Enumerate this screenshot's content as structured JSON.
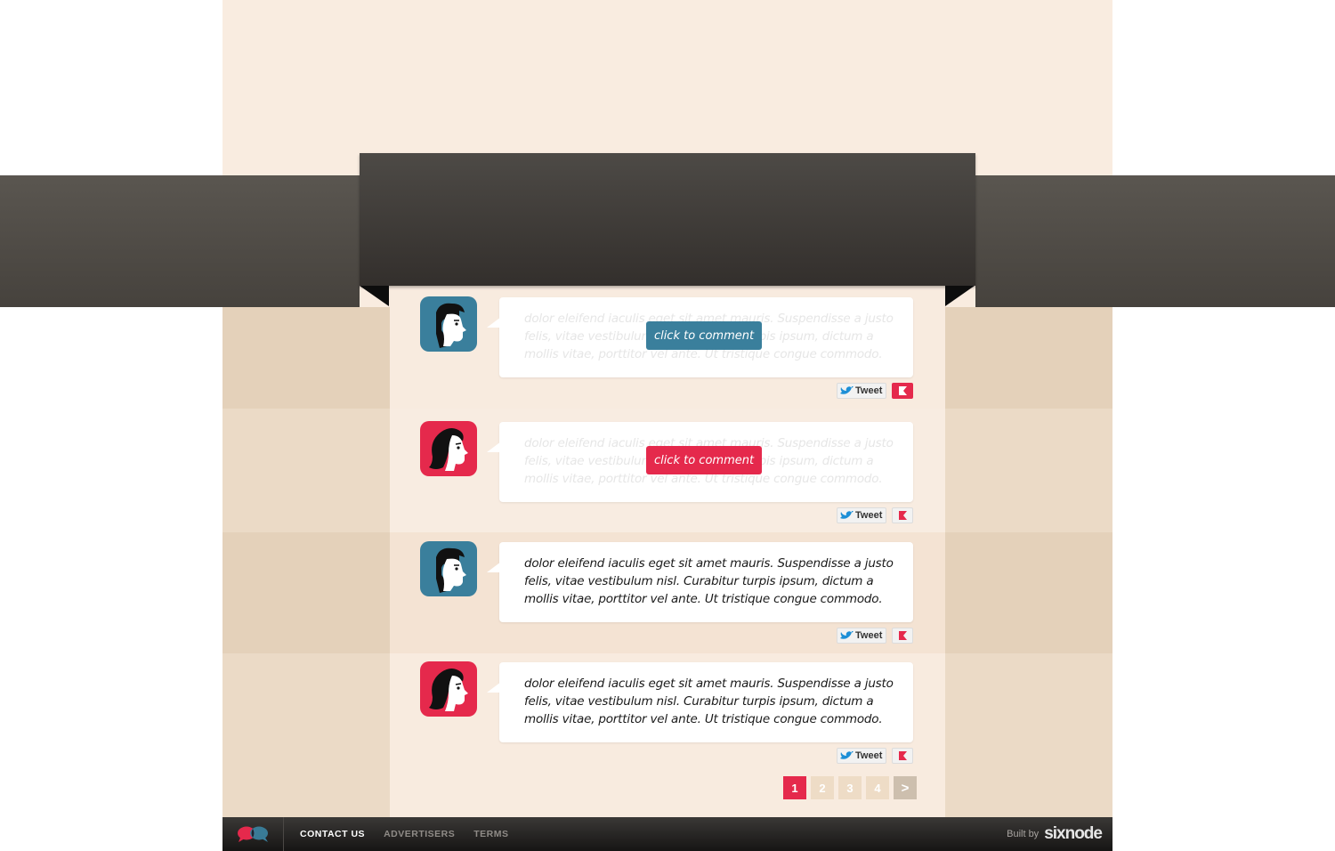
{
  "comments": [
    {
      "avatar": "male-profile-icon",
      "text": "dolor eleifend iaculis eget sit amet mauris. Suspendisse a justo felis, vitae vestibulum nisl. Curabitur turpis ipsum, dictum a mollis vitae, porttitor vel ante. Ut tristique congue commodo.",
      "cta_label": "click to comment",
      "tweet_label": "Tweet"
    },
    {
      "avatar": "female-profile-icon",
      "text": "dolor eleifend iaculis eget sit amet mauris. Suspendisse a justo felis, vitae vestibulum nisl. Curabitur turpis ipsum, dictum a mollis vitae, porttitor vel ante. Ut tristique congue commodo.",
      "cta_label": "click to comment",
      "tweet_label": "Tweet"
    },
    {
      "avatar": "male-profile-icon",
      "text": "dolor eleifend iaculis eget sit amet mauris. Suspendisse a justo felis, vitae vestibulum nisl. Curabitur turpis ipsum, dictum a mollis vitae, porttitor vel ante. Ut tristique congue commodo.",
      "tweet_label": "Tweet"
    },
    {
      "avatar": "female-profile-icon",
      "text": "dolor eleifend iaculis eget sit amet mauris. Suspendisse a justo felis, vitae vestibulum nisl. Curabitur turpis ipsum, dictum a mollis vitae, porttitor vel ante. Ut tristique congue commodo.",
      "tweet_label": "Tweet"
    }
  ],
  "pagination": {
    "pages": [
      "1",
      "2",
      "3",
      "4"
    ],
    "current": "1",
    "next_label": ">"
  },
  "footer": {
    "nav": [
      "CONTACT US",
      "ADVERTISERS",
      "TERMS"
    ],
    "built_by_label": "Built by",
    "brand": "sixnode"
  },
  "colors": {
    "blue": "#3a7f9c",
    "red": "#e5294c",
    "banner": "#3b3835"
  }
}
